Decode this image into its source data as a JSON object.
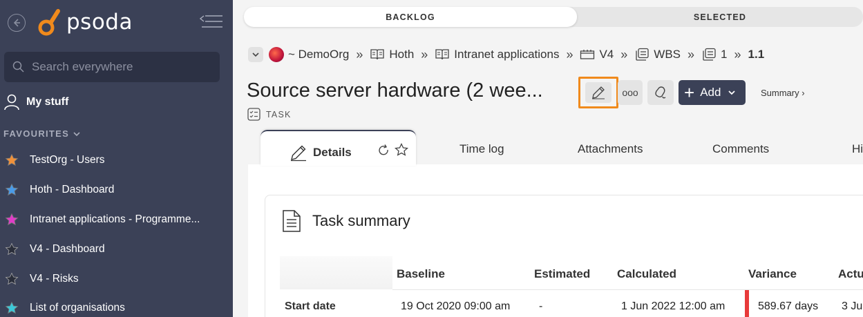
{
  "sidebar": {
    "logo_text": "psoda",
    "search_placeholder": "Search everywhere",
    "my_stuff": "My stuff",
    "favourites_heading": "FAVOURITES",
    "favourites": [
      {
        "label": "TestOrg - Users",
        "color": "#f0913a"
      },
      {
        "label": "Hoth - Dashboard",
        "color": "#4a9be8"
      },
      {
        "label": "Intranet applications - Programme...",
        "color": "#e03cc8"
      },
      {
        "label": "V4 - Dashboard",
        "color": "#2a2e3a"
      },
      {
        "label": "V4 - Risks",
        "color": "#2a2e3a"
      },
      {
        "label": "List of organisations",
        "color": "#3cc8d8"
      }
    ]
  },
  "toggle": {
    "left": "BACKLOG",
    "right": "SELECTED"
  },
  "breadcrumb": {
    "org": "~ DemoOrg",
    "items": [
      "Hoth",
      "Intranet applications",
      "V4",
      "WBS",
      "1"
    ],
    "last": "1.1"
  },
  "page": {
    "title": "Source server hardware (2 wee...",
    "add_label": "Add",
    "more_label": "ooo",
    "summary_link": "Summary ›",
    "type": "TASK"
  },
  "tabs": {
    "active": "Details",
    "others": [
      "Time log",
      "Attachments",
      "Comments",
      "Hi"
    ]
  },
  "card": {
    "title": "Task summary",
    "columns": [
      "Baseline",
      "Estimated",
      "Calculated",
      "Variance",
      "Actu"
    ],
    "row": {
      "label": "Start date",
      "baseline": "19 Oct 2020 09:00 am",
      "estimated": "-",
      "calculated": "1 Jun 2022 12:00 am",
      "variance": "589.67 days",
      "actual": "3 Ju"
    }
  },
  "colors": {
    "sidebar": "#3b4157",
    "accent": "#f08a1c",
    "variance": "#e83a3a"
  }
}
